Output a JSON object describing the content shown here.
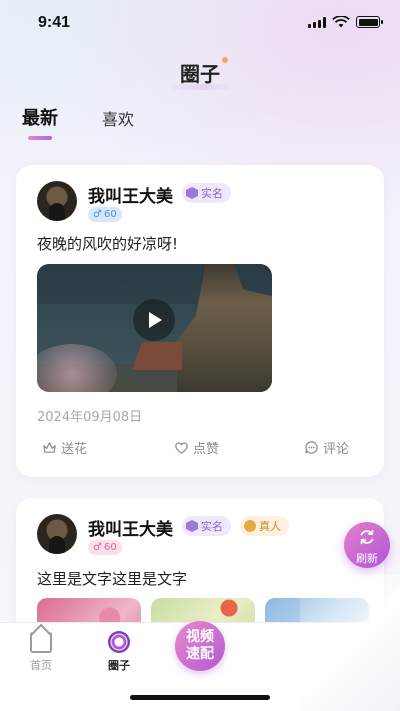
{
  "status_bar": {
    "time": "9:41"
  },
  "header": {
    "title": "圈子"
  },
  "tabs": [
    {
      "label": "最新",
      "active": true
    },
    {
      "label": "喜欢",
      "active": false
    }
  ],
  "posts": [
    {
      "author": "我叫王大美",
      "badges": [
        "实名"
      ],
      "gender": "♂",
      "age": "60",
      "text": "夜晚的风吹的好凉呀!",
      "media": "video",
      "date": "2024年09月08日",
      "actions": {
        "flower": "送花",
        "like": "点赞",
        "comment": "评论"
      }
    },
    {
      "author": "我叫王大美",
      "badges": [
        "实名",
        "真人"
      ],
      "gender": "♂",
      "age": "60",
      "text": "这里是文字这里是文字",
      "media": "images"
    }
  ],
  "refresh": {
    "label": "刷新"
  },
  "bottom_nav": {
    "home": "首页",
    "circle": "圈子",
    "video_match": [
      "视频",
      "速配"
    ]
  },
  "colors": {
    "accent": "#b056d8",
    "accent_pink": "#e37fc9",
    "verified": "#8663c8",
    "real": "#c98a2c"
  }
}
